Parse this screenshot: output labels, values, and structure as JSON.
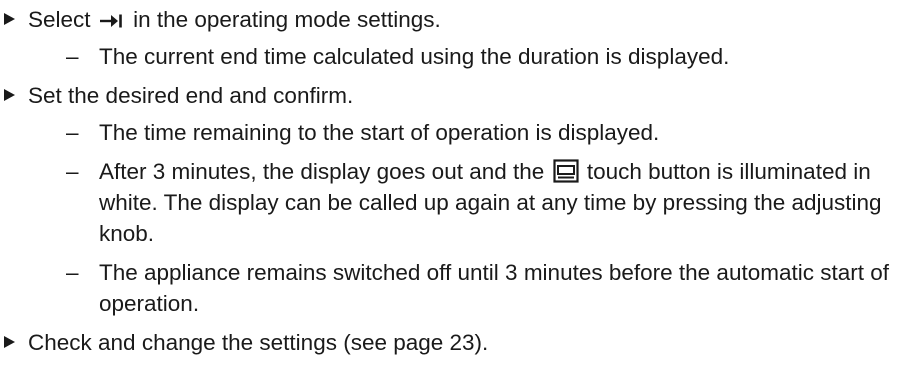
{
  "steps": [
    {
      "text_before": "Select",
      "icon": "end-time-icon",
      "text_after": "in the operating mode settings.",
      "results": [
        "The current end time calculated using the duration is displayed."
      ]
    },
    {
      "text": "Set the desired end and confirm.",
      "results": [
        "The time remaining to the start of operation is displayed.",
        {
          "text_before": "After 3 minutes, the display goes out and the",
          "icon": "display-touch-button-icon",
          "text_after": "touch button is illu­minated in white. The display can be called up again at any time by pressing the adjusting knob."
        },
        "The appliance remains switched off until 3 minutes before the auto­matic start of operation."
      ]
    },
    {
      "text": "Check and change the settings (see page 23)."
    }
  ],
  "dash_char": "–"
}
